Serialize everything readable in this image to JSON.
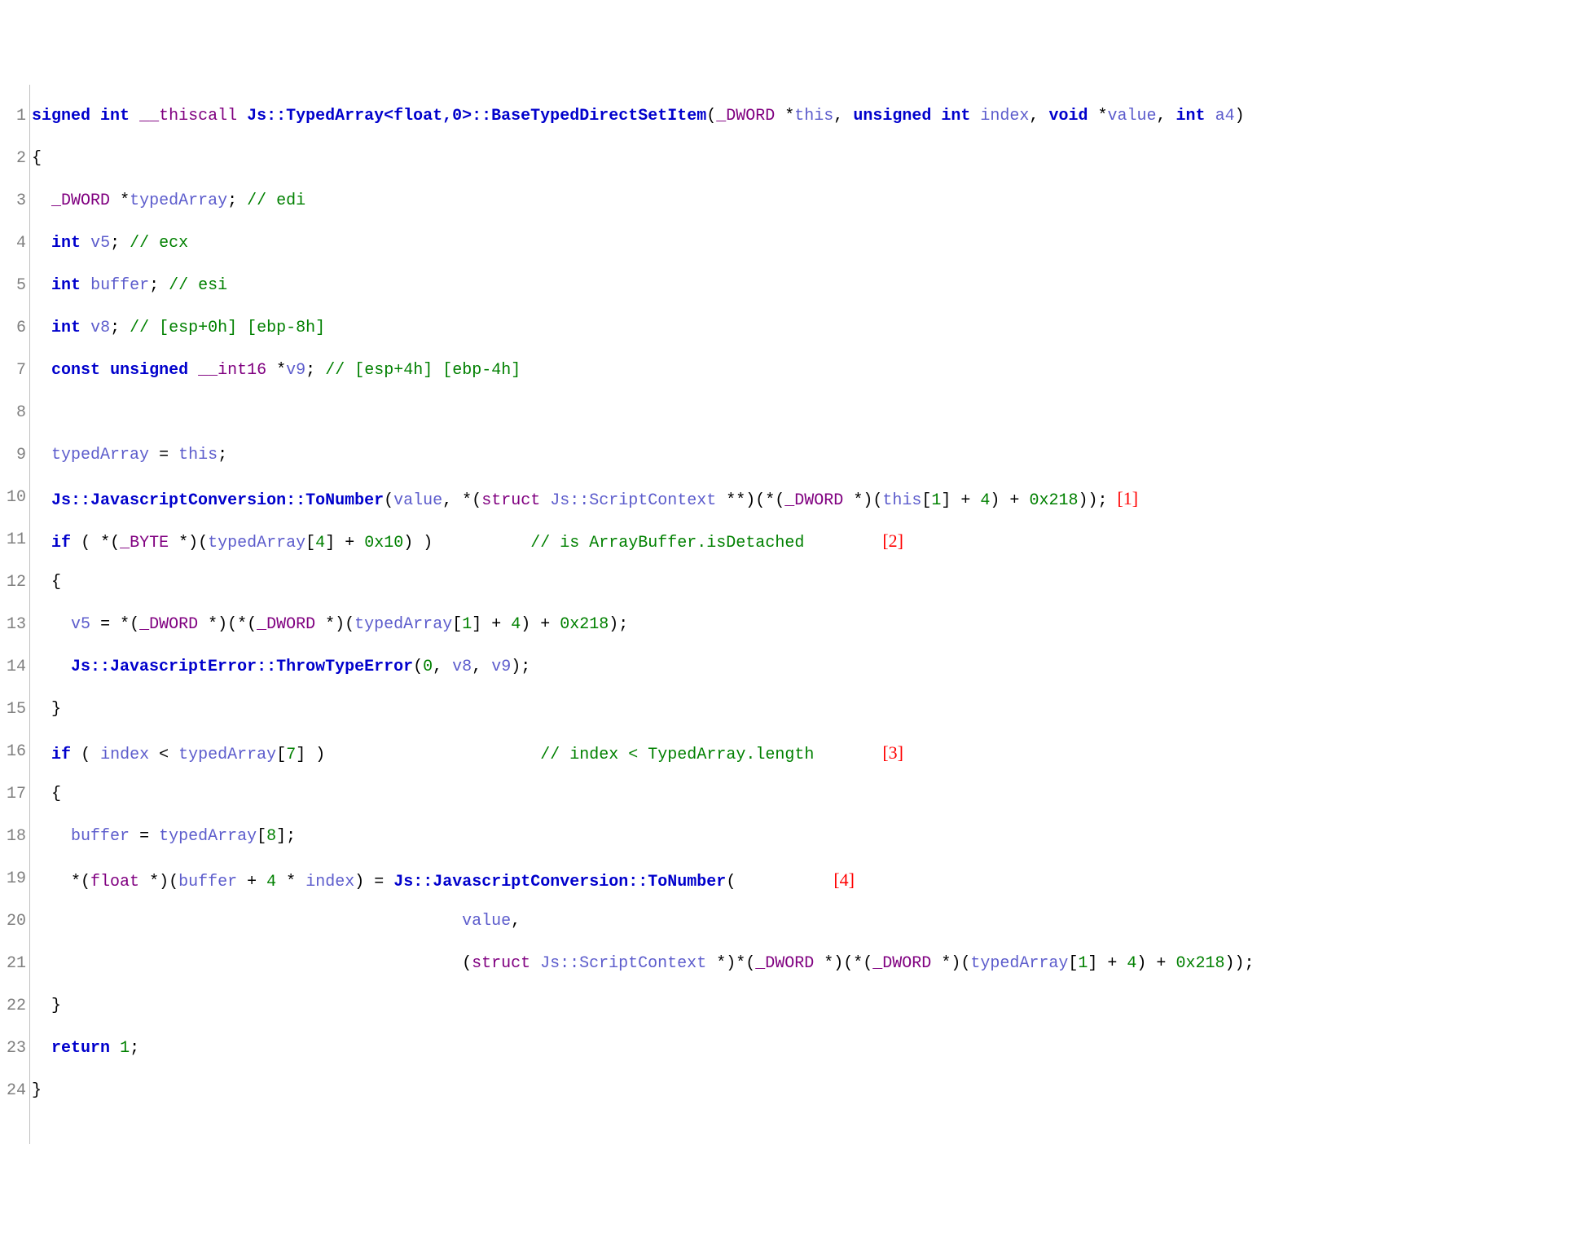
{
  "gutter": [
    "1",
    "2",
    "3",
    "4",
    "5",
    "6",
    "7",
    "8",
    "9",
    "10",
    "11",
    "12",
    "13",
    "14",
    "15",
    "16",
    "17",
    "18",
    "19",
    "20",
    "21",
    "22",
    "23",
    "24"
  ],
  "t": {
    "signed": "signed",
    "int": "int",
    "unsigned": "unsigned",
    "void": "void",
    "if": "if",
    "return": "return",
    "const": "const",
    "thiscall": "__thiscall",
    "DWORD": "_DWORD",
    "BYTE": "_BYTE",
    "int16": "__int16",
    "float": "float",
    "struct": "struct",
    "this": "this",
    "index": "index",
    "value": "value",
    "a4": "a4",
    "typedArray": "typedArray",
    "v5": "v5",
    "buffer": "buffer",
    "v8": "v8",
    "v9": "v9",
    "fnName": "Js::TypedArray<float,0>::BaseTypedDirectSetItem",
    "toNumber": "Js::JavascriptConversion::ToNumber",
    "throwErr": "Js::JavascriptError::ThrowTypeError",
    "scriptCtx": "Js::ScriptContext",
    "edi": "// edi",
    "ecx": "// ecx",
    "esi": "// esi",
    "esp0": "// [esp+0h] [ebp-8h]",
    "esp4": "// [esp+4h] [ebp-4h]",
    "cmtDetached": "// is ArrayBuffer.isDetached",
    "cmtLength": "// index < TypedArray.length",
    "n0": "0",
    "n1": "1",
    "n4": "4",
    "n7": "7",
    "n8": "8",
    "h10": "0x10",
    "h218": "0x218",
    "ann1": "[1]",
    "ann2": "[2]",
    "ann3": "[3]",
    "ann4": "[4]"
  }
}
